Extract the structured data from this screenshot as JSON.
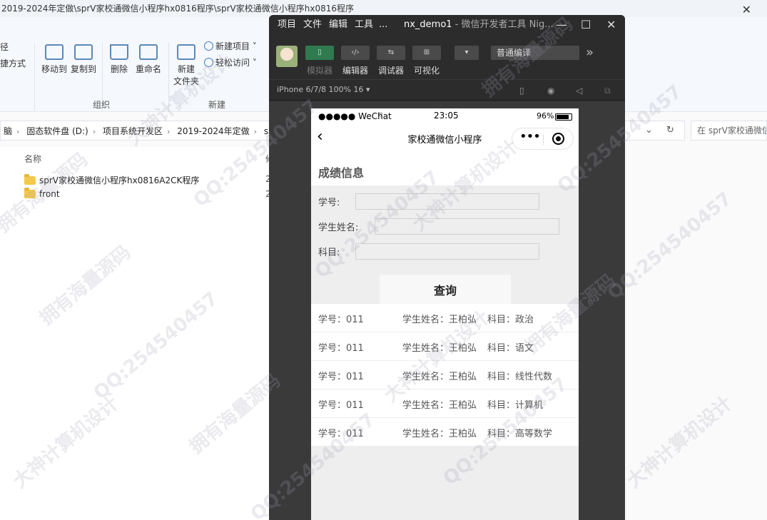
{
  "explorer": {
    "title": "2019-2024年定做\\sprV家校通微信小程序hx0816程序\\sprV家校通微信小程序hx0816程序",
    "ribbon": {
      "path_label": "径",
      "shortcut_label": "捷方式",
      "move_to": "移动到",
      "copy_to": "复制到",
      "delete": "删除",
      "rename": "重命名",
      "organize": "组织",
      "new_folder_line1": "新建",
      "new_folder_line2": "文件夹",
      "new_item": "新建项目",
      "easy_access": "轻松访问",
      "new_group": "新建"
    },
    "breadcrumbs": [
      "脑",
      "固态软件盘 (D:)",
      "项目系统开发区",
      "2019-2024年定做",
      "s"
    ],
    "search_placeholder": "在 sprV家校通微信",
    "list": {
      "col_name": "名称",
      "col_other": "修",
      "files": [
        {
          "name": "sprV家校通微信小程序hx0816A2CK程序",
          "col": "2"
        },
        {
          "name": "front",
          "col": "2"
        }
      ]
    }
  },
  "devtools": {
    "menu": [
      "项目",
      "文件",
      "编辑",
      "工具",
      "..."
    ],
    "title": "nx_demo1",
    "title_sub": " - 微信开发者工具 Nig...",
    "toolbar": {
      "simulator": "模拟器",
      "editor": "编辑器",
      "debugger": "调试器",
      "visual": "可视化",
      "compile_mode": "普通编译"
    },
    "device": "iPhone 6/7/8 100% 16"
  },
  "phone": {
    "status": {
      "carrier": "●●●●● WeChat",
      "time": "23:05",
      "battery": "96%"
    },
    "nav_title": "家校通微信小程序",
    "page_title": "成绩信息",
    "form": {
      "student_id_label": "学号:",
      "student_name_label": "学生姓名:",
      "subject_label": "科目:",
      "query_button": "查询"
    },
    "results": [
      {
        "id": "学号：011",
        "name": "学生姓名：王柏弘",
        "subject": "科目：政治"
      },
      {
        "id": "学号：011",
        "name": "学生姓名：王柏弘",
        "subject": "科目：语文"
      },
      {
        "id": "学号：011",
        "name": "学生姓名：王柏弘",
        "subject": "科目：线性代数"
      },
      {
        "id": "学号：011",
        "name": "学生姓名：王柏弘",
        "subject": "科目：计算机"
      },
      {
        "id": "学号：011",
        "name": "学生姓名：王柏弘",
        "subject": "科目：高等数学"
      }
    ]
  },
  "watermark": {
    "texts": [
      "拥有海量源码",
      "QQ:254540457",
      "大神计算机设计"
    ]
  }
}
